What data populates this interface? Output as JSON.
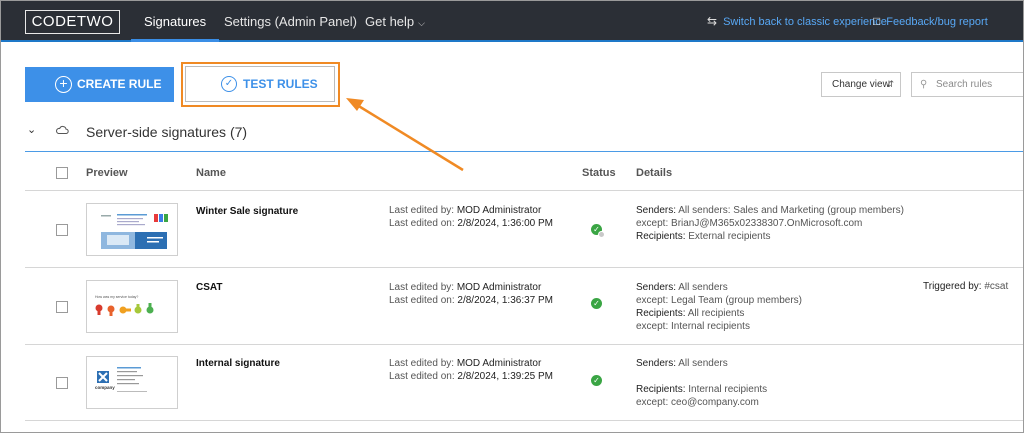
{
  "header": {
    "logo": "CODETWO",
    "nav": [
      {
        "label": "Signatures",
        "active": true
      },
      {
        "label": "Settings (Admin Panel)",
        "active": false
      },
      {
        "label": "Get help",
        "active": false
      }
    ],
    "switch_classic": "Switch back to classic experience",
    "feedback": "Feedback/bug report"
  },
  "toolbar": {
    "create_rule": "CREATE RULE",
    "test_rules": "TEST RULES",
    "change_view": "Change view",
    "search_placeholder": "Search rules"
  },
  "group": {
    "title": "Server-side signatures (7)"
  },
  "table": {
    "headers": [
      "Preview",
      "Name",
      "Status",
      "Details"
    ],
    "rows": [
      {
        "name": "Winter Sale signature",
        "edited_by_label": "Last edited by:",
        "edited_by": "MOD Administrator",
        "edited_on_label": "Last edited on:",
        "edited_on": "2/8/2024, 1:36:00 PM",
        "details": [
          {
            "label": "Senders:",
            "value": "All senders: Sales and Marketing (group members)"
          },
          {
            "label": "",
            "value": "except: BrianJ@M365x02338307.OnMicrosoft.com"
          },
          {
            "label": "Recipients:",
            "value": "External recipients"
          }
        ],
        "triggered_label": "",
        "triggered_value": ""
      },
      {
        "name": "CSAT",
        "edited_by_label": "Last edited by:",
        "edited_by": "MOD Administrator",
        "edited_on_label": "Last edited on:",
        "edited_on": "2/8/2024, 1:36:37 PM",
        "details": [
          {
            "label": "Senders:",
            "value": "All senders"
          },
          {
            "label": "",
            "value": "except: Legal Team (group members)"
          },
          {
            "label": "Recipients:",
            "value": "All recipients"
          },
          {
            "label": "",
            "value": "except: Internal recipients"
          }
        ],
        "triggered_label": "Triggered by:",
        "triggered_value": "#csat"
      },
      {
        "name": "Internal signature",
        "edited_by_label": "Last edited by:",
        "edited_by": "MOD Administrator",
        "edited_on_label": "Last edited on:",
        "edited_on": "2/8/2024, 1:39:25 PM",
        "details": [
          {
            "label": "Senders:",
            "value": "All senders"
          },
          {
            "label": "",
            "value": ""
          },
          {
            "label": "Recipients:",
            "value": "Internal recipients"
          },
          {
            "label": "",
            "value": "except: ceo@company.com"
          }
        ],
        "triggered_label": "",
        "triggered_value": ""
      }
    ]
  },
  "thumbnails": {
    "csat_question": "How was my service today?",
    "internal_logo_text": "company"
  },
  "colors": {
    "topbar": "#2b2f36",
    "accent": "#3d90e8",
    "highlight": "#f08a24",
    "status_ok": "#3aa544"
  }
}
